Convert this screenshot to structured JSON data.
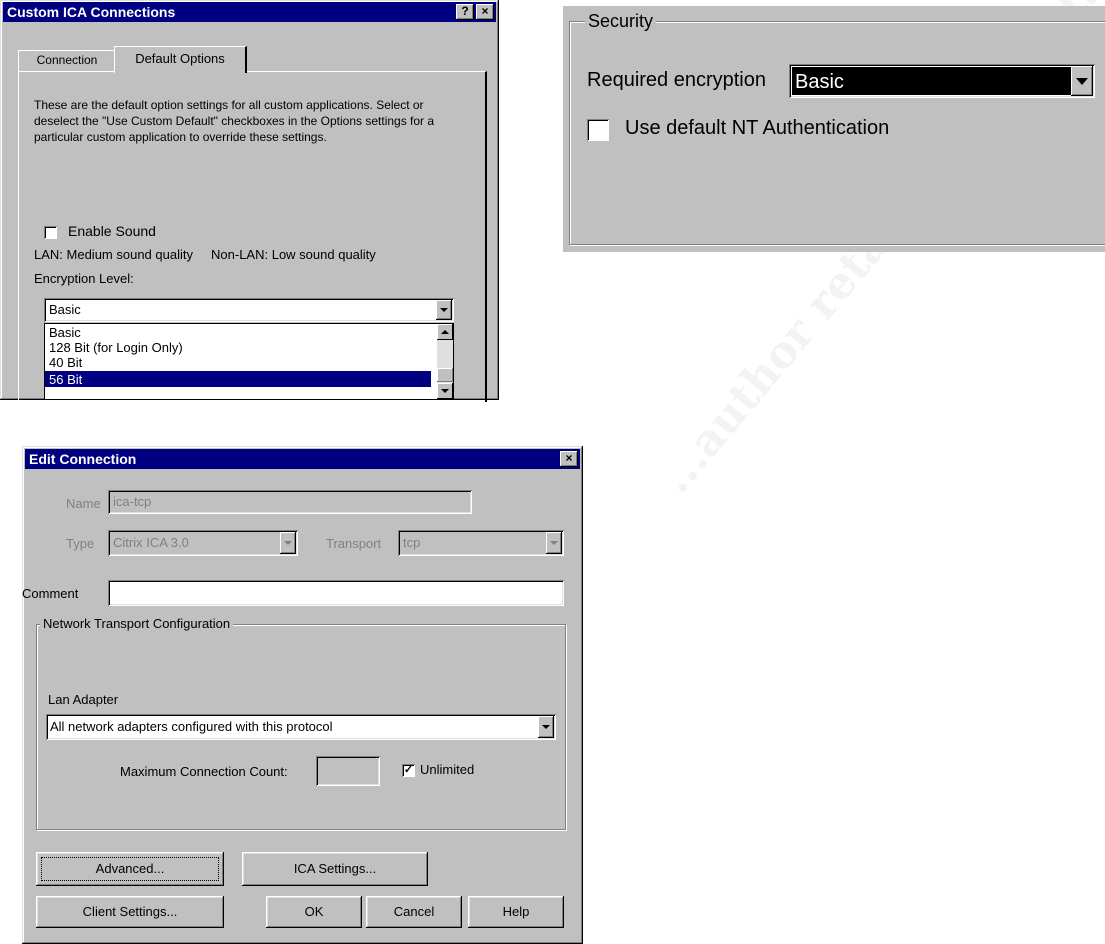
{
  "watermark": "...author retains full rights.",
  "custom_ica": {
    "title": "Custom ICA Connections",
    "help_glyph": "?",
    "close_glyph": "×",
    "tabs": [
      "Connection",
      "Default Options"
    ],
    "description": "These are the default option settings for all custom applications. Select or deselect the \"Use Custom Default\" checkboxes in the Options settings for a particular custom application to override these settings.",
    "enable_sound_label": "Enable Sound",
    "enable_sound_checked": false,
    "sound_quality": "LAN: Medium sound quality     Non-LAN: Low sound quality",
    "encryption_label": "Encryption Level:",
    "encryption_value": "Basic",
    "encryption_options": [
      "Basic",
      "128 Bit (for Login Only)",
      "40 Bit",
      "56 Bit"
    ],
    "selected_option_index": 3
  },
  "security": {
    "group_label": "Security",
    "required_label": "Required encryption",
    "required_value": "Basic",
    "nt_auth_label": "Use default NT Authentication",
    "nt_auth_checked": false
  },
  "edit_connection": {
    "title": "Edit Connection",
    "close_glyph": "×",
    "name_label": "Name",
    "name_value": "ica-tcp",
    "type_label": "Type",
    "type_value": "Citrix ICA 3.0",
    "transport_label": "Transport",
    "transport_value": "tcp",
    "comment_label": "Comment",
    "comment_value": "",
    "network_group_label": "Network Transport Configuration",
    "lan_adapter_label": "Lan Adapter",
    "lan_adapter_value": "All network adapters configured with this protocol",
    "max_conn_label": "Maximum Connection Count:",
    "max_conn_value": "",
    "unlimited_label": "Unlimited",
    "unlimited_checked": true,
    "buttons": {
      "advanced": "Advanced...",
      "ica_settings": "ICA Settings...",
      "client_settings": "Client Settings...",
      "ok": "OK",
      "cancel": "Cancel",
      "help": "Help"
    }
  }
}
